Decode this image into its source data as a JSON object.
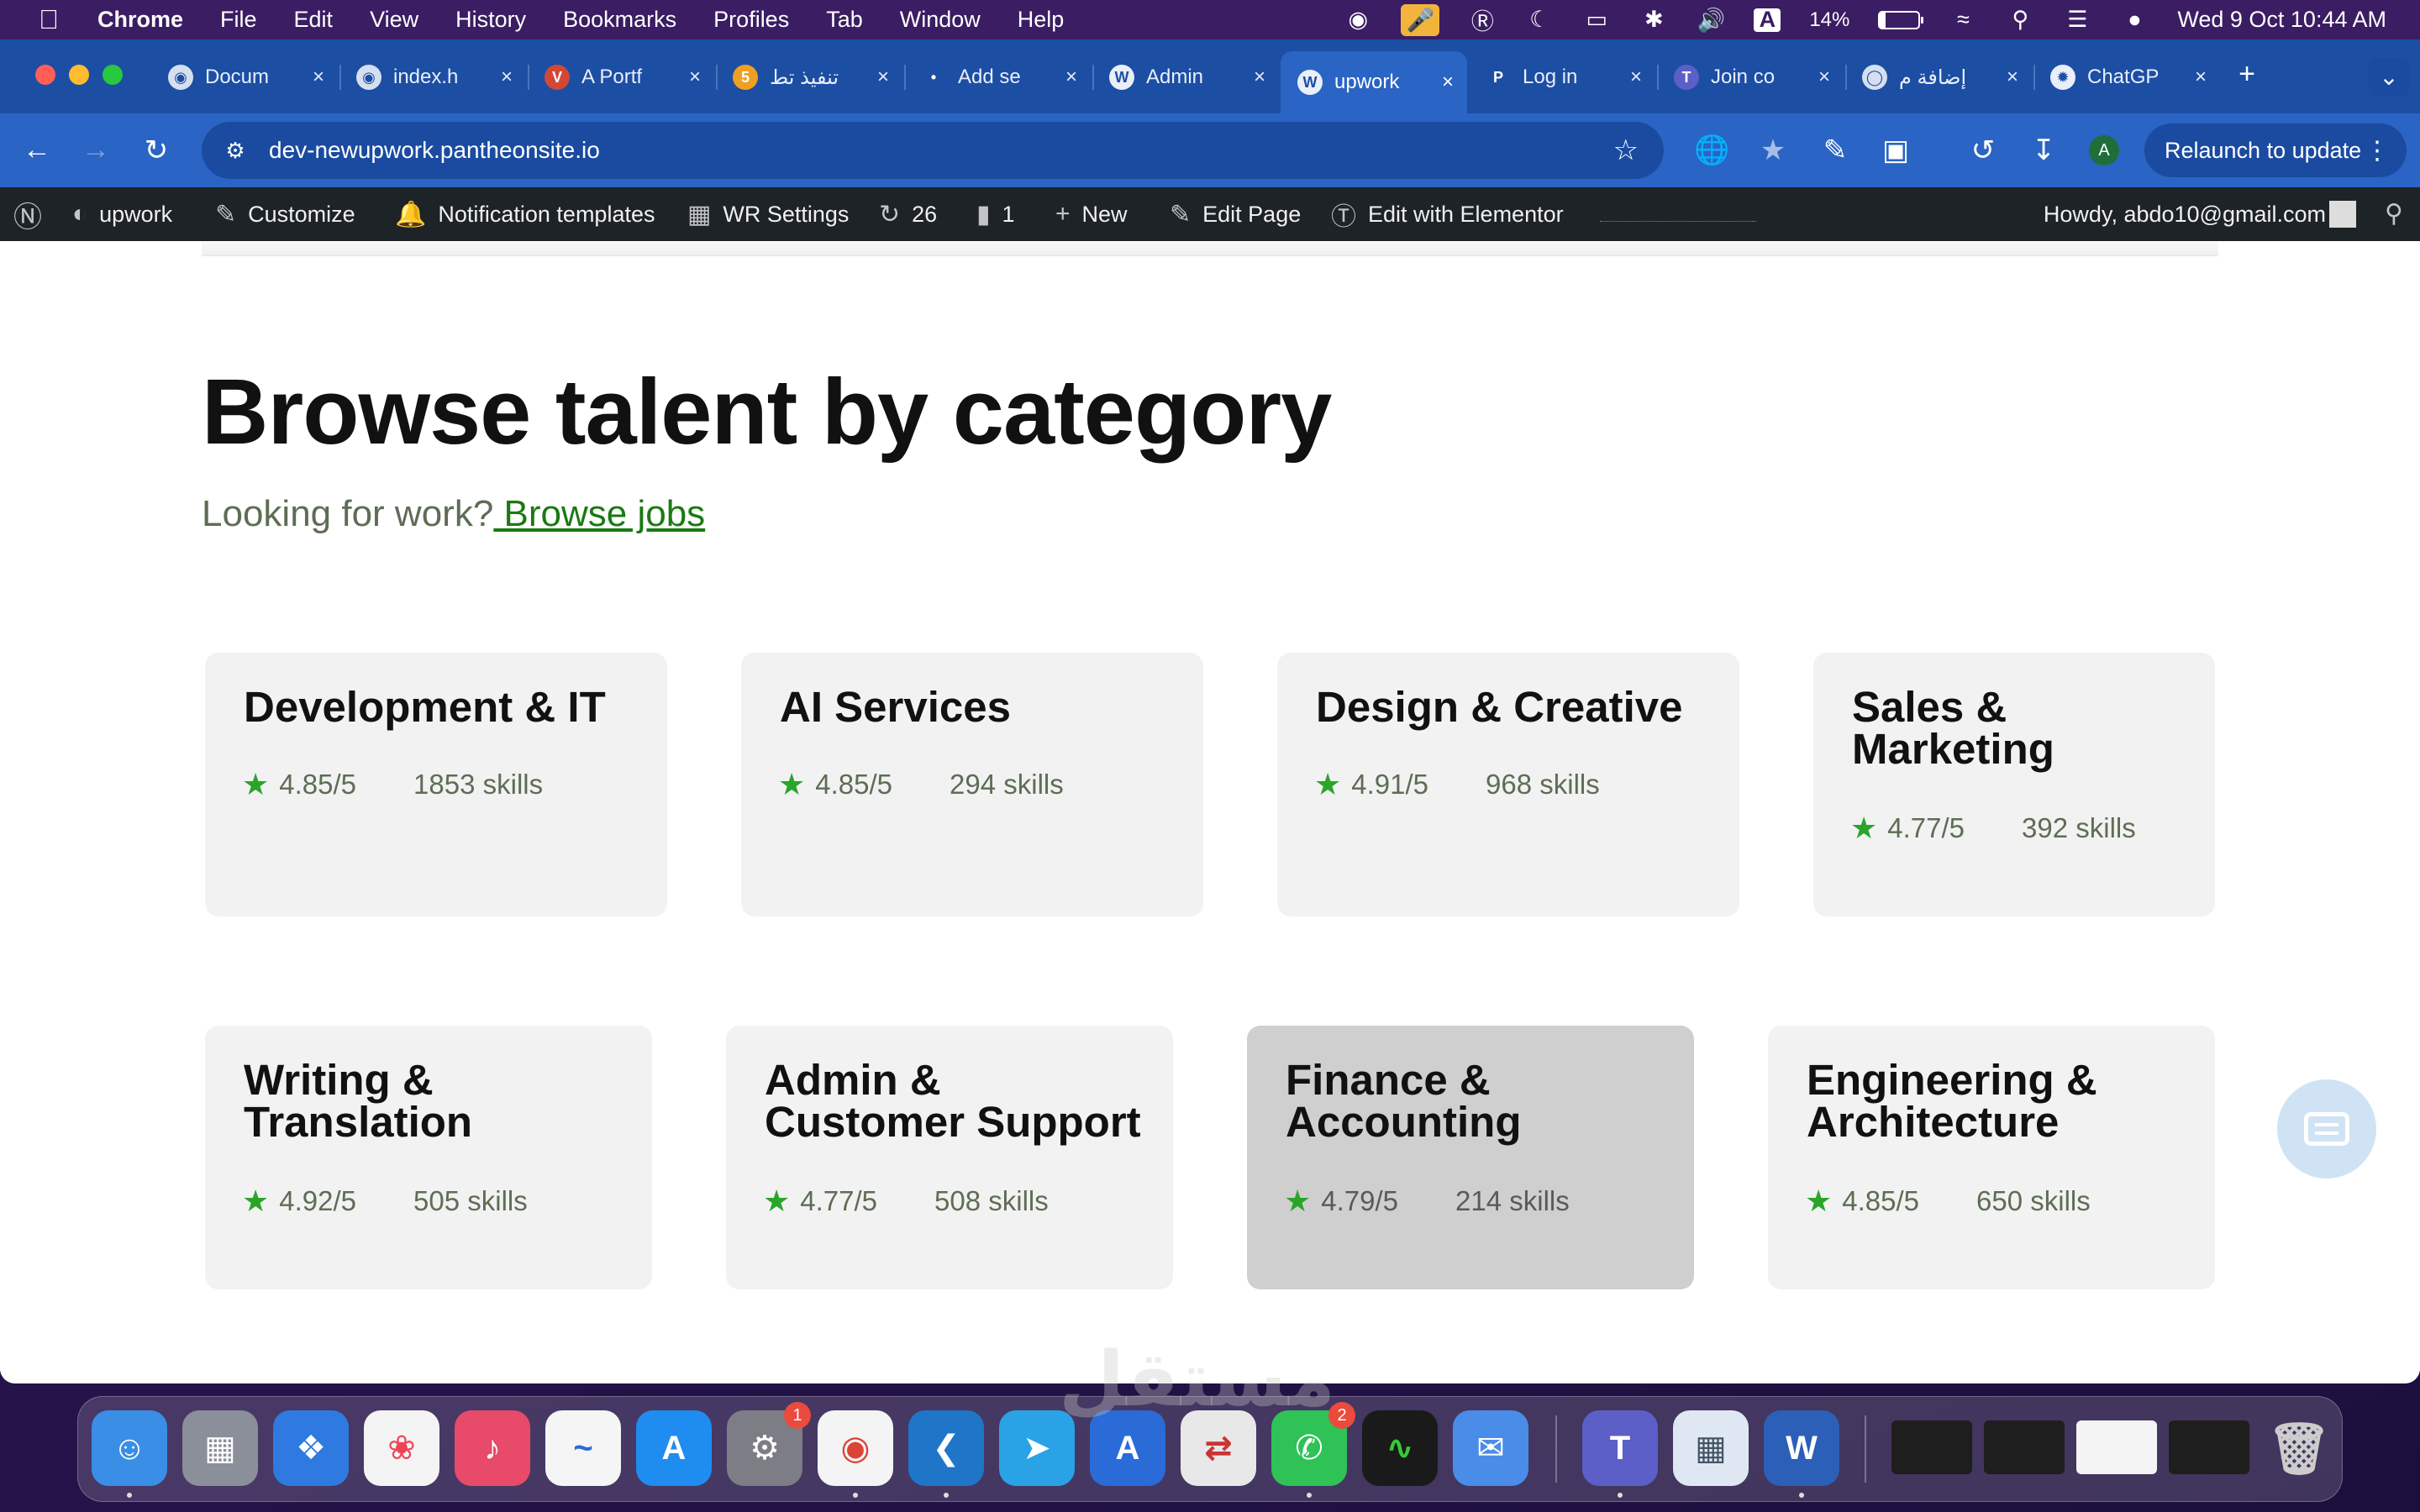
{
  "menubar": {
    "app": "Chrome",
    "items": [
      "File",
      "Edit",
      "View",
      "History",
      "Bookmarks",
      "Profiles",
      "Tab",
      "Window",
      "Help"
    ],
    "battery": "14%",
    "battery_level": 0.14,
    "input_source": "A",
    "datetime": "Wed 9 Oct  10:44 AM"
  },
  "tabs": [
    {
      "title": "Docum",
      "icon": "globe-icon"
    },
    {
      "title": "index.h",
      "icon": "globe-icon"
    },
    {
      "title": "A Portf",
      "icon": "portfolio-icon"
    },
    {
      "title": "تنفيذ تط",
      "icon": "html5-icon"
    },
    {
      "title": "Add se",
      "icon": "upwork-icon"
    },
    {
      "title": "Admin",
      "icon": "wordpress-icon"
    },
    {
      "title": "upwork",
      "icon": "wordpress-icon"
    },
    {
      "title": "Log in",
      "icon": "paypal-icon"
    },
    {
      "title": "Join co",
      "icon": "teams-icon"
    },
    {
      "title": "إضافة م",
      "icon": "circle-icon"
    },
    {
      "title": "ChatGP",
      "icon": "chatgpt-icon"
    }
  ],
  "active_tab_index": 6,
  "address": {
    "url": "dev-newupwork.pantheonsite.io"
  },
  "toolbar": {
    "relaunch": "Relaunch to update",
    "profile_initial": "A"
  },
  "wpbar": {
    "site": "upwork",
    "customize": "Customize",
    "notifications": "Notification templates",
    "wr_settings": "WR Settings",
    "updates": "26",
    "comments": "1",
    "new": "New",
    "edit_page": "Edit Page",
    "elementor": "Edit with Elementor",
    "howdy": "Howdy, abdo10@gmail.com"
  },
  "page": {
    "title": "Browse talent by category",
    "subtitle": "Looking for work?",
    "browse_link": " Browse jobs"
  },
  "categories": [
    {
      "name": "Development & IT",
      "rating": "4.85/5",
      "skills": "1853 skills"
    },
    {
      "name": "AI Services",
      "rating": "4.85/5",
      "skills": "294 skills"
    },
    {
      "name": "Design & Creative",
      "rating": "4.91/5",
      "skills": "968 skills"
    },
    {
      "name": "Sales & Marketing",
      "rating": "4.77/5",
      "skills": "392 skills"
    },
    {
      "name": "Writing & Translation",
      "rating": "4.92/5",
      "skills": "505 skills"
    },
    {
      "name": "Admin & Customer Support",
      "rating": "4.77/5",
      "skills": "508 skills"
    },
    {
      "name": "Finance & Accounting",
      "rating": "4.79/5",
      "skills": "214 skills"
    },
    {
      "name": "Engineering & Architecture",
      "rating": "4.85/5",
      "skills": "650 skills"
    }
  ],
  "dock": {
    "apps": [
      "Finder",
      "Launchpad",
      "Safari",
      "Photos",
      "Music",
      "Freeform",
      "App Store",
      "System Settings",
      "Chrome",
      "VS Code",
      "Telegram",
      "Xcode",
      "Migration",
      "WhatsApp",
      "Activity Monitor",
      "Mail",
      "Teams",
      "Preview",
      "Word"
    ],
    "badges": {
      "System Settings": "1",
      "WhatsApp": "2"
    }
  },
  "watermark": "مستقل"
}
